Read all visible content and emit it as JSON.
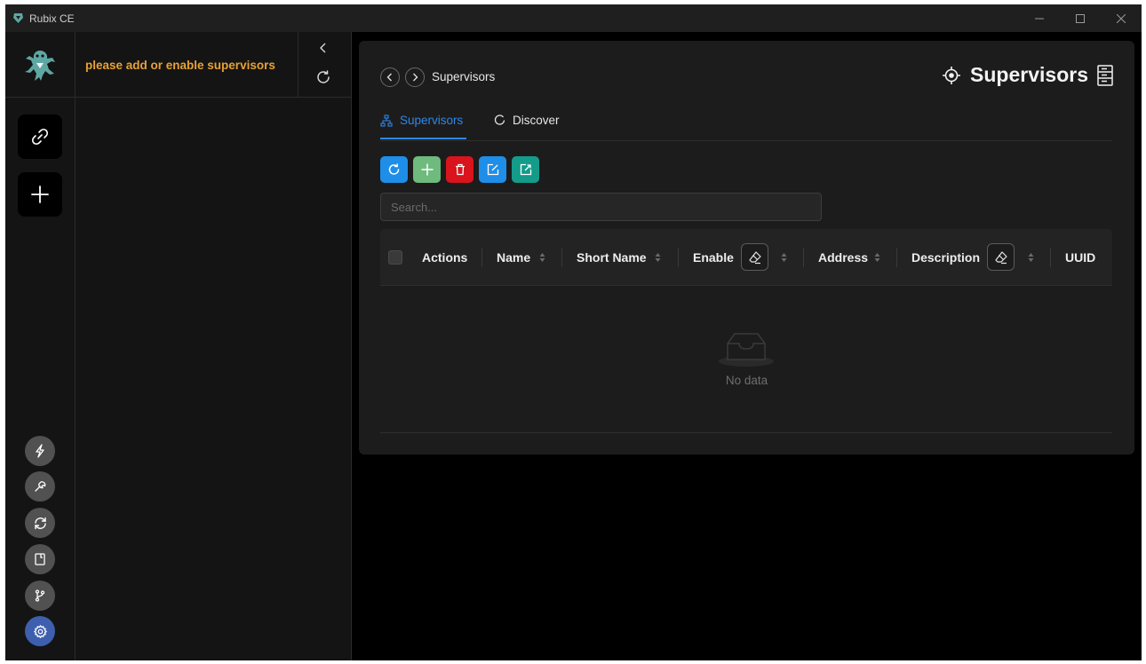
{
  "window": {
    "title": "Rubix CE"
  },
  "sidepanel": {
    "warning": "please add or enable supervisors"
  },
  "header": {
    "breadcrumb": "Supervisors",
    "page_title": "Supervisors"
  },
  "tabs": [
    {
      "label": "Supervisors",
      "icon": "hierarchy-icon",
      "active": true
    },
    {
      "label": "Discover",
      "icon": "loading-circle-icon",
      "active": false
    }
  ],
  "toolbar": {
    "buttons": [
      {
        "name": "refresh",
        "icon": "refresh-icon",
        "color": "#1f8ee8"
      },
      {
        "name": "add",
        "icon": "plus-icon",
        "color": "#6fba7d"
      },
      {
        "name": "delete",
        "icon": "trash-icon",
        "color": "#d9141c"
      },
      {
        "name": "edit",
        "icon": "edit-icon",
        "color": "#1f8ee8"
      },
      {
        "name": "export",
        "icon": "export-icon",
        "color": "#149b8a"
      }
    ]
  },
  "search": {
    "placeholder": "Search...",
    "value": ""
  },
  "table": {
    "columns": [
      "Actions",
      "Name",
      "Short Name",
      "Enable",
      "Address",
      "Description",
      "UUID"
    ],
    "rows": [],
    "empty_text": "No data"
  },
  "colors": {
    "accent": "#2f86e8",
    "warning": "#e8a135",
    "active_settings": "#3d5fae"
  }
}
